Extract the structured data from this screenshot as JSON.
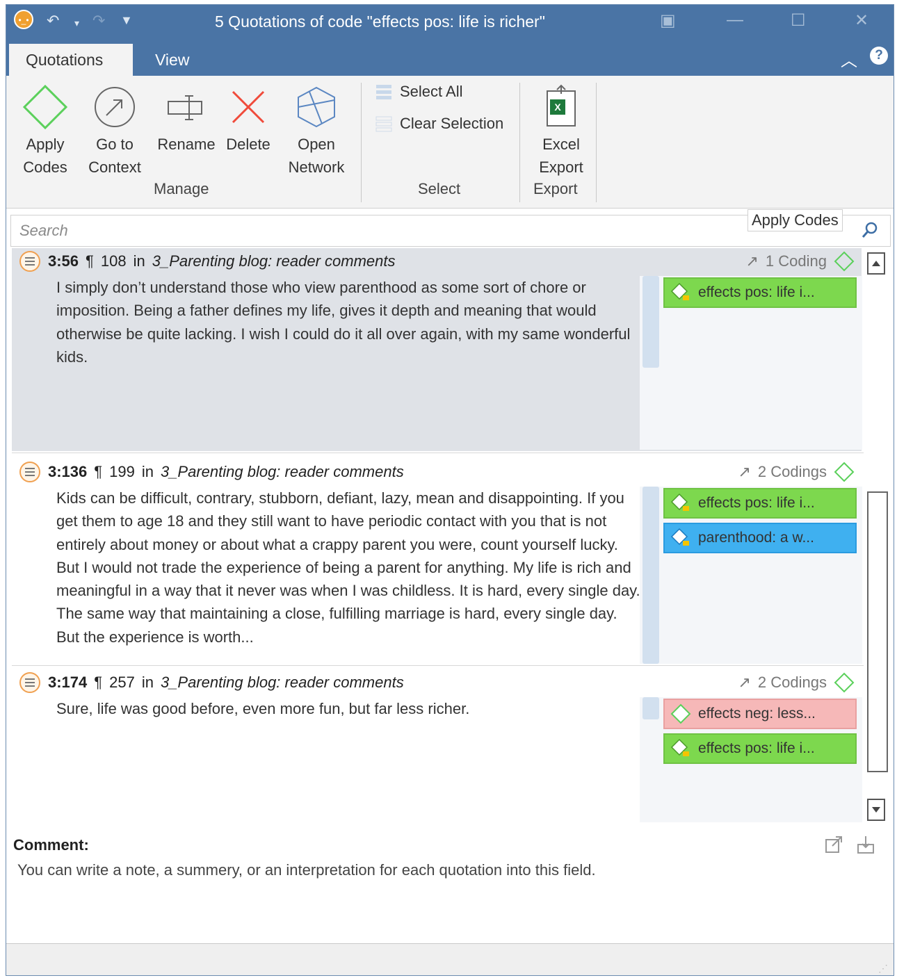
{
  "window": {
    "title": "5 Quotations of code \"effects pos: life is richer\""
  },
  "tabs": [
    {
      "label": "Quotations",
      "active": true
    },
    {
      "label": "View",
      "active": false
    }
  ],
  "ribbon": {
    "manage": {
      "group_label": "Manage",
      "apply_codes": "Apply\nCodes",
      "go_to_context": "Go to\nContext",
      "rename": "Rename",
      "delete": "Delete",
      "open_network": "Open\nNetwork"
    },
    "select": {
      "group_label": "Select",
      "select_all": "Select All",
      "clear_selection": "Clear Selection"
    },
    "export": {
      "group_label": "Export",
      "excel_export": "Excel\nExport"
    }
  },
  "search": {
    "placeholder": "Search",
    "apply_codes_label": "Apply Codes"
  },
  "quotations": [
    {
      "id": "3:56",
      "para": "¶",
      "line": "108",
      "in_label": "in",
      "document": "3_Parenting blog: reader comments",
      "codings_label": "1 Coding",
      "text": "I simply don’t understand those who view parenthood as some sort of chore or imposition. Being a father defines my life, gives it depth and meaning that would otherwise be quite lacking. I wish I could do it all over again, with my same wonderful kids.",
      "codes": [
        {
          "label": "effects pos: life i...",
          "color": "green"
        }
      ]
    },
    {
      "id": "3:136",
      "para": "¶",
      "line": "199",
      "in_label": "in",
      "document": "3_Parenting blog: reader comments",
      "codings_label": "2 Codings",
      "text": "Kids can be difficult, contrary, stubborn, defiant, lazy, mean and disappointing. If you get them to age 18 and they still want to have periodic contact with you that is not entirely about money or about what a crappy parent you were, count yourself lucky. But I would not trade the experience of being a parent for anything. My life is rich and meaningful in a way that it never was when I was childless. It is hard, every single day. The same way that maintaining a close, fulfilling marriage is hard, every single day. But the experience is worth...",
      "codes": [
        {
          "label": "effects pos: life i...",
          "color": "green"
        },
        {
          "label": "parenthood: a w...",
          "color": "blue"
        }
      ]
    },
    {
      "id": "3:174",
      "para": "¶",
      "line": "257",
      "in_label": "in",
      "document": "3_Parenting blog: reader comments",
      "codings_label": "2 Codings",
      "text": "Sure, life was good before, even more fun, but far less richer.",
      "codes": [
        {
          "label": "effects neg: less...",
          "color": "pink"
        },
        {
          "label": "effects pos: life i...",
          "color": "green"
        }
      ]
    }
  ],
  "comment": {
    "label": "Comment:",
    "text": "You can write a note, a summery, or an interpretation for each quotation into this field."
  },
  "colors": {
    "titlebar": "#4a74a5",
    "code_green": "#7dd84e",
    "code_blue": "#3fb0f0",
    "code_pink": "#f6b8b8",
    "selected_row": "#dfe2e7"
  }
}
